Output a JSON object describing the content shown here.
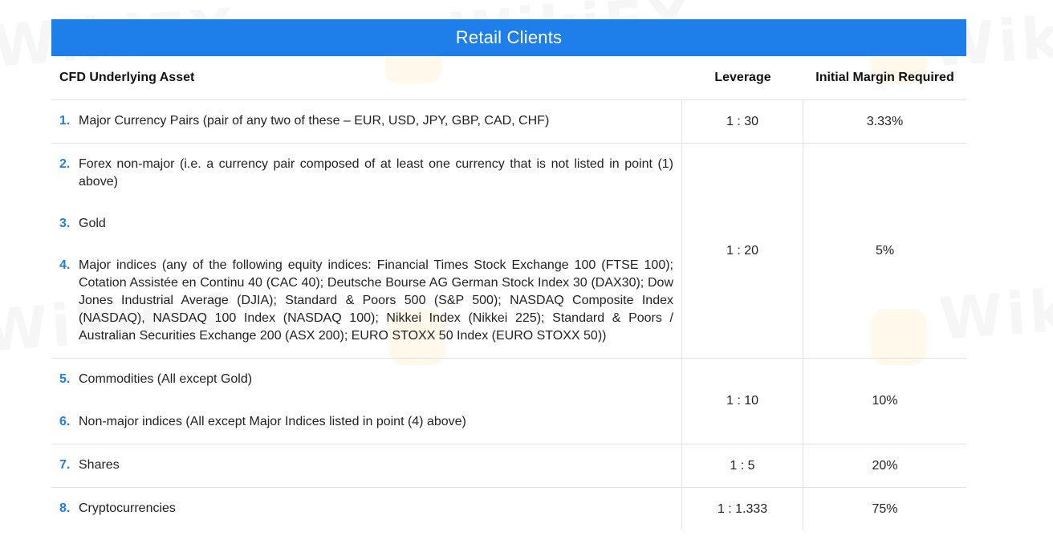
{
  "table": {
    "title": "Retail Clients",
    "headers": {
      "asset": "CFD Underlying Asset",
      "leverage": "Leverage",
      "margin": "Initial Margin Required"
    },
    "groups": [
      {
        "leverage": "1 : 30",
        "margin": "3.33%",
        "items": [
          {
            "num": "1.",
            "text": "Major Currency Pairs (pair of any two of these – EUR, USD, JPY, GBP, CAD, CHF)"
          }
        ]
      },
      {
        "leverage": "1 : 20",
        "margin": "5%",
        "items": [
          {
            "num": "2.",
            "text": "Forex non-major (i.e. a currency pair composed of at least one currency that is not listed in point (1) above)"
          },
          {
            "num": "3.",
            "text": "Gold"
          },
          {
            "num": "4.",
            "text": "Major indices (any of the following equity indices: Financial Times Stock Exchange 100 (FTSE 100); Cotation Assistée en Continu 40 (CAC 40); Deutsche Bourse AG German Stock Index 30 (DAX30); Dow Jones Industrial Average (DJIA); Standard & Poors 500 (S&P 500); NASDAQ Composite Index (NASDAQ), NASDAQ 100 Index (NASDAQ 100); Nikkei Index (Nikkei 225); Standard & Poors / Australian Securities Exchange 200 (ASX 200); EURO STOXX 50 Index (EURO STOXX 50))"
          }
        ]
      },
      {
        "leverage": "1 : 10",
        "margin": "10%",
        "items": [
          {
            "num": "5.",
            "text": "Commodities (All except Gold)"
          },
          {
            "num": "6.",
            "text": "Non-major indices (All except Major Indices listed in point (4) above)"
          }
        ]
      },
      {
        "leverage": "1 : 5",
        "margin": "20%",
        "items": [
          {
            "num": "7.",
            "text": "Shares"
          }
        ]
      },
      {
        "leverage": "1 : 1.333",
        "margin": "75%",
        "items": [
          {
            "num": "8.",
            "text": "Cryptocurrencies"
          }
        ]
      }
    ]
  },
  "watermark": {
    "text": "WikiFX",
    "icon": "wikifx-logo-icon"
  },
  "colors": {
    "banner": "#1f7fea",
    "number": "#1f7fea",
    "border": "#e2e2e2"
  }
}
